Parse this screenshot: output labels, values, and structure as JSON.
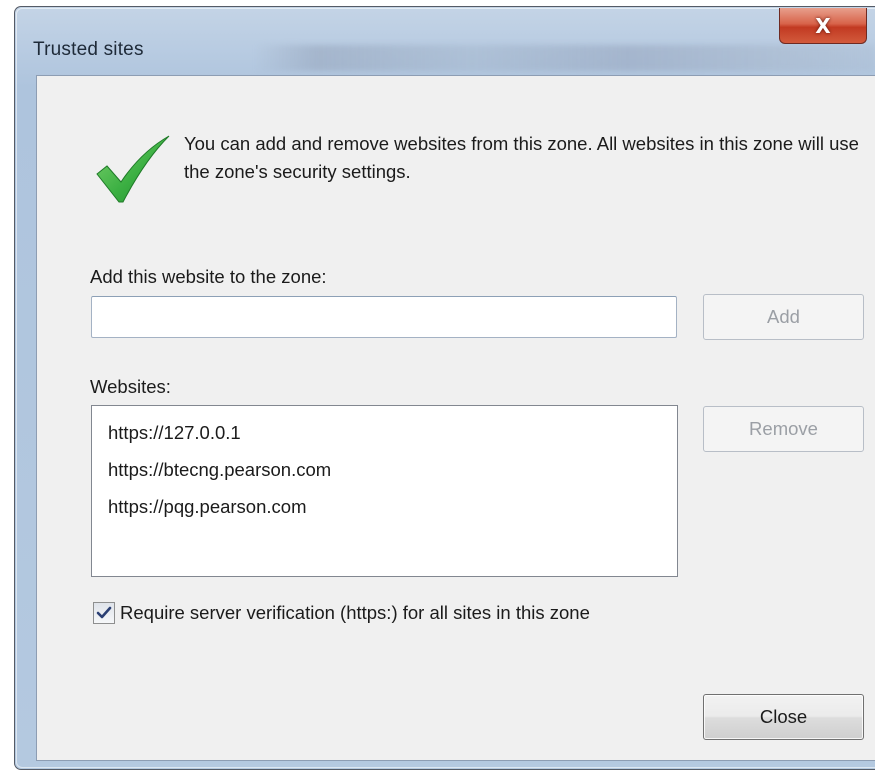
{
  "window": {
    "title": "Trusted sites",
    "close_glyph": "X"
  },
  "info": {
    "icon": "checkmark-icon",
    "text": "You can add and remove websites from this zone. All websites in this zone will use the zone's security settings."
  },
  "add_section": {
    "label": "Add this website to the zone:",
    "input_value": "",
    "add_button": "Add",
    "add_enabled": false
  },
  "websites": {
    "label": "Websites:",
    "items": [
      "https://127.0.0.1",
      "https://btecng.pearson.com",
      "https://pqg.pearson.com"
    ],
    "remove_button": "Remove",
    "remove_enabled": false
  },
  "verification": {
    "label": "Require server verification (https:) for all sites in this zone",
    "checked": true
  },
  "footer": {
    "close_button": "Close"
  },
  "colors": {
    "check_green": "#3cb043",
    "title_bar": "#b9cce2",
    "close_red": "#c23a22",
    "dialog_bg": "#f0f0f0"
  }
}
